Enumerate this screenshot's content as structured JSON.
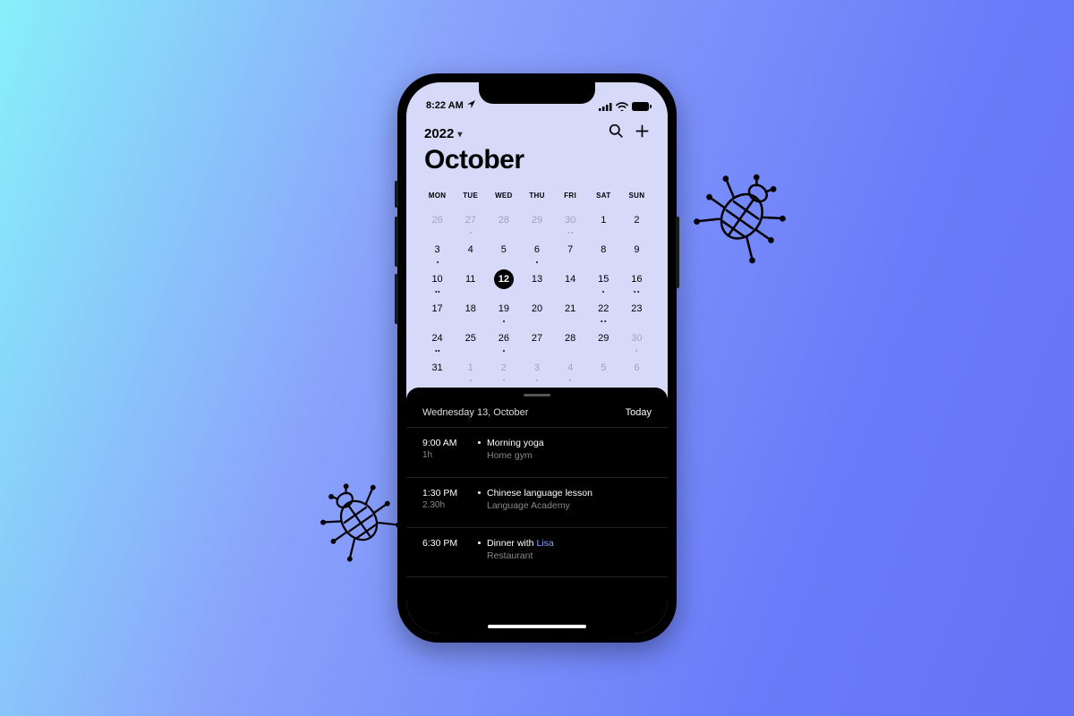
{
  "statusbar": {
    "time": "8:22 AM"
  },
  "header": {
    "year": "2022",
    "month": "October",
    "icons": {
      "search": "search-icon",
      "add": "plus-icon"
    }
  },
  "weekdays": [
    "MON",
    "TUE",
    "WED",
    "THU",
    "FRI",
    "SAT",
    "SUN"
  ],
  "weeks": [
    [
      {
        "n": "26",
        "faded": true,
        "dots": 0
      },
      {
        "n": "27",
        "faded": true,
        "dots": 1
      },
      {
        "n": "28",
        "faded": true,
        "dots": 0
      },
      {
        "n": "29",
        "faded": true,
        "dots": 0
      },
      {
        "n": "30",
        "faded": true,
        "dots": 2
      },
      {
        "n": "1",
        "dots": 0
      },
      {
        "n": "2",
        "dots": 0
      }
    ],
    [
      {
        "n": "3",
        "dots": 1
      },
      {
        "n": "4",
        "dots": 0
      },
      {
        "n": "5",
        "dots": 0
      },
      {
        "n": "6",
        "dots": 1
      },
      {
        "n": "7",
        "dots": 0
      },
      {
        "n": "8",
        "dots": 0
      },
      {
        "n": "9",
        "dots": 0
      }
    ],
    [
      {
        "n": "10",
        "dots": 2
      },
      {
        "n": "11",
        "dots": 0
      },
      {
        "n": "12",
        "dots": 0,
        "selected": true
      },
      {
        "n": "13",
        "dots": 0
      },
      {
        "n": "14",
        "dots": 0
      },
      {
        "n": "15",
        "dots": 1
      },
      {
        "n": "16",
        "dots": 2
      }
    ],
    [
      {
        "n": "17",
        "dots": 0
      },
      {
        "n": "18",
        "dots": 0
      },
      {
        "n": "19",
        "dots": 1
      },
      {
        "n": "20",
        "dots": 0
      },
      {
        "n": "21",
        "dots": 0
      },
      {
        "n": "22",
        "dots": 2
      },
      {
        "n": "23",
        "dots": 0
      }
    ],
    [
      {
        "n": "24",
        "dots": 2
      },
      {
        "n": "25",
        "dots": 0
      },
      {
        "n": "26",
        "dots": 1
      },
      {
        "n": "27",
        "dots": 0
      },
      {
        "n": "28",
        "dots": 0
      },
      {
        "n": "29",
        "dots": 0
      },
      {
        "n": "30",
        "faded": true,
        "dots": 1
      }
    ],
    [
      {
        "n": "31",
        "dots": 0
      },
      {
        "n": "1",
        "faded": true,
        "dots": 1
      },
      {
        "n": "2",
        "faded": true,
        "dots": 1
      },
      {
        "n": "3",
        "faded": true,
        "dots": 1
      },
      {
        "n": "4",
        "faded": true,
        "dots": 1
      },
      {
        "n": "5",
        "faded": true,
        "dots": 0
      },
      {
        "n": "6",
        "faded": true,
        "dots": 0
      }
    ]
  ],
  "agenda": {
    "date": "Wednesday 13, October",
    "today_label": "Today",
    "events": [
      {
        "time": "9:00 AM",
        "duration": "1h",
        "title_pre": "Morning yoga",
        "title_person": "",
        "location": "Home gym"
      },
      {
        "time": "1:30 PM",
        "duration": "2.30h",
        "title_pre": "Chinese language lesson",
        "title_person": "",
        "location": "Language Academy"
      },
      {
        "time": "6:30 PM",
        "duration": "",
        "title_pre": "Dinner with ",
        "title_person": "Lisa",
        "location": "Restaurant"
      }
    ]
  }
}
